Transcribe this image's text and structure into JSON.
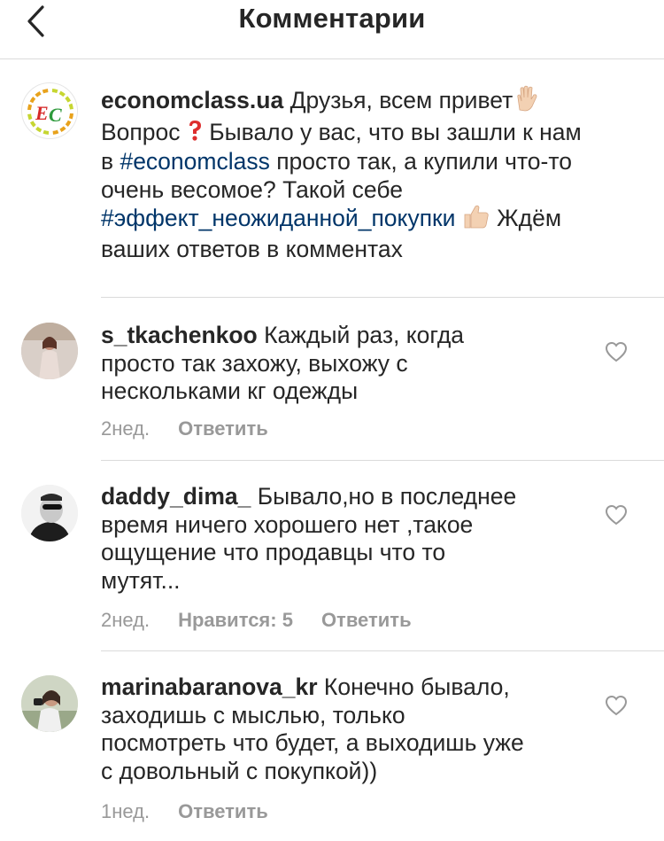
{
  "header": {
    "title": "Комментарии",
    "back_icon": "chevron-left-icon"
  },
  "caption": {
    "username": "economclass.ua",
    "logo_text": "EC",
    "line1_text": " Друзья, всем привет",
    "line2_a": "Вопрос ",
    "line2_b": " Бывало у вас, что вы зашли к нам",
    "line3_a": "в ",
    "hashtag1": "#economclass",
    "line3_b": " просто так, а купили что-то",
    "line4": "очень весомое? Такой себе",
    "hashtag2": "#эффект_неожиданной_покупки",
    "line5_b": " Ждём",
    "line6": "ваших ответов в комментах",
    "emoji_hand": "raised-hand-emoji",
    "emoji_question": "red-question-mark-emoji",
    "emoji_thumbs": "thumbs-up-emoji"
  },
  "comments": [
    {
      "username": "s_tkachenkoo",
      "lines": [
        " Каждый раз, когда",
        "просто так захожу, выхожу с",
        "нескольками кг одежды"
      ],
      "time": "2нед.",
      "reply": "Ответить",
      "likes": ""
    },
    {
      "username": "daddy_dima_",
      "lines": [
        " Бывало,но в последнее",
        "время ничего хорошего нет ,такое",
        "ощущение что продавцы что то",
        "мутят..."
      ],
      "time": "2нед.",
      "likes": "Нравится: 5",
      "reply": "Ответить"
    },
    {
      "username": "marinabaranova_kr",
      "lines": [
        " Конечно бывало,",
        "заходишь с мыслью, только",
        "посмотреть что будет, а выходишь уже",
        "с довольный с покупкой))"
      ],
      "time": "1нед.",
      "reply": "Ответить",
      "likes": ""
    }
  ],
  "colors": {
    "text": "#262626",
    "hashtag": "#003569",
    "meta": "#999999",
    "divider": "#dbdbdb"
  }
}
